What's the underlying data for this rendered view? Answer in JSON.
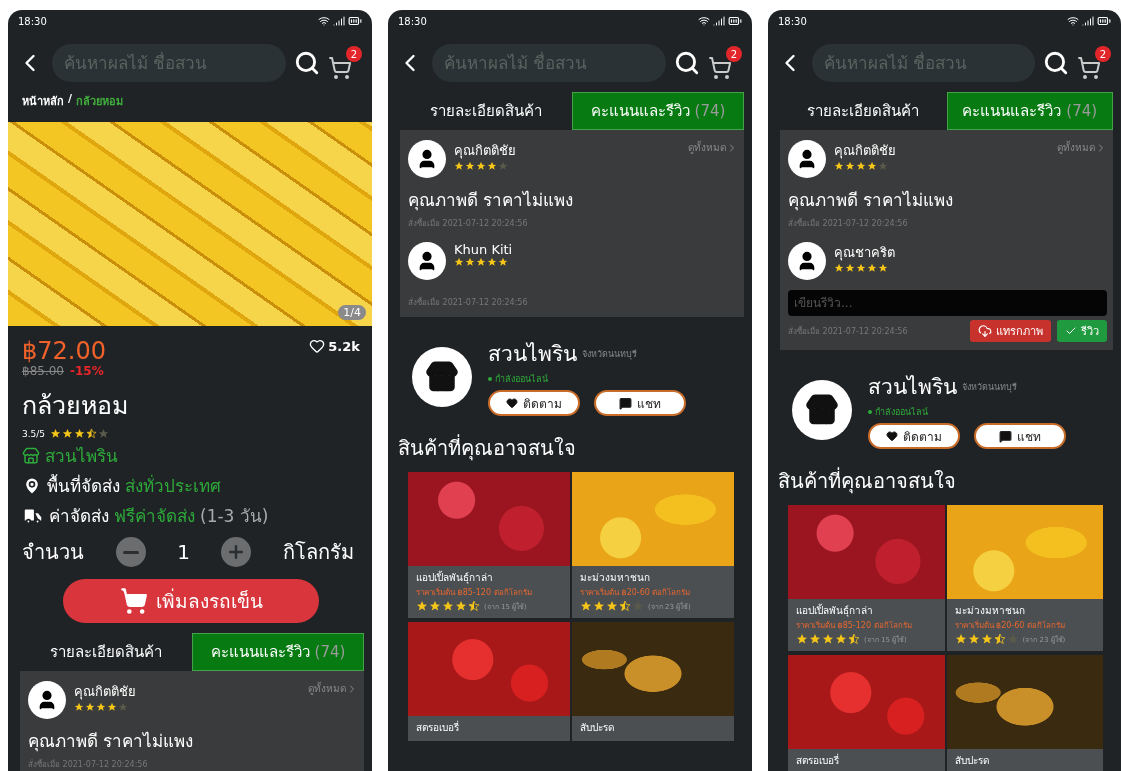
{
  "phones": [
    {
      "status_time": "18:30",
      "search": {
        "placeholder": "ค้นหาผลไม้ ชื่อสวน"
      },
      "cart_count": "2",
      "sections": [
        {
          "kind": "breadcrumb",
          "separator": "/",
          "items": [
            {
              "label": "หน้าหลัก",
              "current": false
            },
            {
              "label": "กล้วยหอม",
              "current": true
            }
          ]
        },
        {
          "kind": "gallery",
          "counter": "1/4"
        },
        {
          "kind": "product",
          "price": "฿72.00",
          "old_price": "฿85.00",
          "discount": "-15%",
          "likes": "5.2k",
          "name": "กล้วยหอม",
          "rating": "3.5/5",
          "stars": 3.5,
          "shop": "สวนไพริน",
          "delivery": [
            {
              "kind": "area",
              "label": "พื้นที่จัดส่ง",
              "value": "ส่งทั่วประเทศ"
            },
            {
              "kind": "shipping",
              "label": "ค่าจัดส่ง",
              "value": "ฟรีค่าจัดส่ง",
              "note": "(1-3 วัน)"
            }
          ],
          "quantity": {
            "label": "จำนวน",
            "value": "1",
            "unit": "กิโลกรัม"
          },
          "add_button": "เพิ่มลงรถเข็น"
        },
        {
          "kind": "tabs",
          "tabs": [
            {
              "label": "รายละเอียดสินค้า",
              "selected": false
            },
            {
              "label": "คะแนนและรีวิว",
              "count": "(74)",
              "selected": true
            }
          ]
        },
        {
          "kind": "reviews",
          "see_all": "ดูทั้งหมด",
          "items": [
            {
              "name": "คุณกิตติชัย",
              "stars": 4,
              "comment": "คุณภาพดี ราคาไม่แพง",
              "date": "สั่งซื้อเมื่อ 2021-07-12 20:24:56"
            }
          ]
        }
      ]
    },
    {
      "status_time": "18:30",
      "search": {
        "placeholder": "ค้นหาผลไม้ ชื่อสวน"
      },
      "cart_count": "2",
      "sections": [
        {
          "kind": "tabs",
          "tabs": [
            {
              "label": "รายละเอียดสินค้า",
              "selected": false
            },
            {
              "label": "คะแนนและรีวิว",
              "count": "(74)",
              "selected": true
            }
          ]
        },
        {
          "kind": "reviews",
          "see_all": "ดูทั้งหมด",
          "items": [
            {
              "name": "คุณกิตติชัย",
              "stars": 4,
              "comment": "คุณภาพดี ราคาไม่แพง",
              "date": "สั่งซื้อเมื่อ 2021-07-12 20:24:56"
            },
            {
              "name": "Khun Kiti",
              "stars": 5,
              "date": "สั่งซื้อเมื่อ 2021-07-12 20:24:56"
            }
          ]
        },
        {
          "kind": "shop",
          "name": "สวนไพริน",
          "province": "จังหวัดนนทบุรี",
          "status": "กำลังออนไลน์",
          "follow_button": "ติดตาม",
          "chat_button": "แชท"
        },
        {
          "kind": "recommendations",
          "title": "สินค้าที่คุณอาจสนใจ",
          "items": [
            {
              "kind": "apple",
              "name": "แอปเปิ้ลพันธุ์กาล่า",
              "price": "ราคาเริ่มต้น ฿85-120 ต่อกิโลกรัม",
              "stars": 4.5,
              "count": "(จาก 15 ผู้ใช้)"
            },
            {
              "kind": "mango",
              "name": "มะม่วงมหาชนก",
              "price": "ราคาเริ่มต้น ฿20-60 ต่อกิโลกรัม",
              "stars": 3.5,
              "count": "(จาก 23 ผู้ใช้)"
            },
            {
              "kind": "strawberry",
              "name": "สตรอเบอรี่"
            },
            {
              "kind": "pineapple",
              "name": "สับปะรด"
            }
          ]
        }
      ]
    },
    {
      "status_time": "18:30",
      "search": {
        "placeholder": "ค้นหาผลไม้ ชื่อสวน"
      },
      "cart_count": "2",
      "sections": [
        {
          "kind": "tabs",
          "tabs": [
            {
              "label": "รายละเอียดสินค้า",
              "selected": false
            },
            {
              "label": "คะแนนและรีวิว",
              "count": "(74)",
              "selected": true
            }
          ]
        },
        {
          "kind": "reviews",
          "see_all": "ดูทั้งหมด",
          "items": [
            {
              "name": "คุณกิตติชัย",
              "stars": 4,
              "comment": "คุณภาพดี ราคาไม่แพง",
              "date": "สั่งซื้อเมื่อ 2021-07-12 20:24:56"
            },
            {
              "name": "คุณชาคริต",
              "stars": 5,
              "composer": {
                "placeholder": "เขียนรีวิว...",
                "date": "สั่งซื้อเมื่อ 2021-07-12 20:24:56",
                "attach_button": "แทรกภาพ",
                "submit_button": "รีวิว"
              }
            }
          ]
        },
        {
          "kind": "shop",
          "name": "สวนไพริน",
          "province": "จังหวัดนนทบุรี",
          "status": "กำลังออนไลน์",
          "follow_button": "ติดตาม",
          "chat_button": "แชท"
        },
        {
          "kind": "recommendations",
          "title": "สินค้าที่คุณอาจสนใจ",
          "items": [
            {
              "kind": "apple",
              "name": "แอปเปิ้ลพันธุ์กาล่า",
              "price": "ราคาเริ่มต้น ฿85-120 ต่อกิโลกรัม",
              "stars": 4.5,
              "count": "(จาก 15 ผู้ใช้)"
            },
            {
              "kind": "mango",
              "name": "มะม่วงมหาชนก",
              "price": "ราคาเริ่มต้น ฿20-60 ต่อกิโลกรัม",
              "stars": 3.5,
              "count": "(จาก 23 ผู้ใช้)"
            },
            {
              "kind": "strawberry",
              "name": "สตรอเบอรี่"
            },
            {
              "kind": "pineapple",
              "name": "สับปะรด"
            }
          ]
        }
      ]
    }
  ]
}
